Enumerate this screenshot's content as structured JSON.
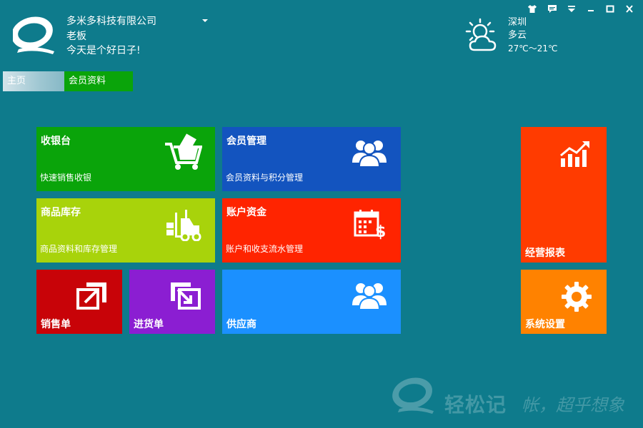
{
  "header": {
    "company": "多米多科技有限公司",
    "role": "老板",
    "greeting": "今天是个好日子!"
  },
  "weather": {
    "city": "深圳",
    "condition": "多云",
    "temperature": "27℃～21℃",
    "icon": "partly-cloudy-icon"
  },
  "tabs": [
    {
      "label": "主页"
    },
    {
      "label": "会员资料"
    }
  ],
  "tiles": {
    "cashier": {
      "title": "收银台",
      "subtitle": "快速销售收银",
      "color": "#0aa40a"
    },
    "member": {
      "title": "会员管理",
      "subtitle": "会员资料与积分管理",
      "color": "#1354bf"
    },
    "inventory": {
      "title": "商品库存",
      "subtitle": "商品资料和库存管理",
      "color": "#a8d30b"
    },
    "accounts": {
      "title": "账户资金",
      "subtitle": "账户和收支流水管理",
      "color": "#ff2400"
    },
    "sales_order": {
      "title": "销售单",
      "color": "#c80308"
    },
    "purchase_order": {
      "title": "进货单",
      "color": "#8b1ed2"
    },
    "supplier": {
      "title": "供应商",
      "color": "#1b90ff"
    },
    "reports": {
      "title": "经营报表",
      "color": "#ff3b00"
    },
    "settings": {
      "title": "系统设置",
      "color": "#ff8200"
    }
  },
  "watermark": {
    "brand": "轻松记",
    "slogan": "帐，超乎想象"
  }
}
